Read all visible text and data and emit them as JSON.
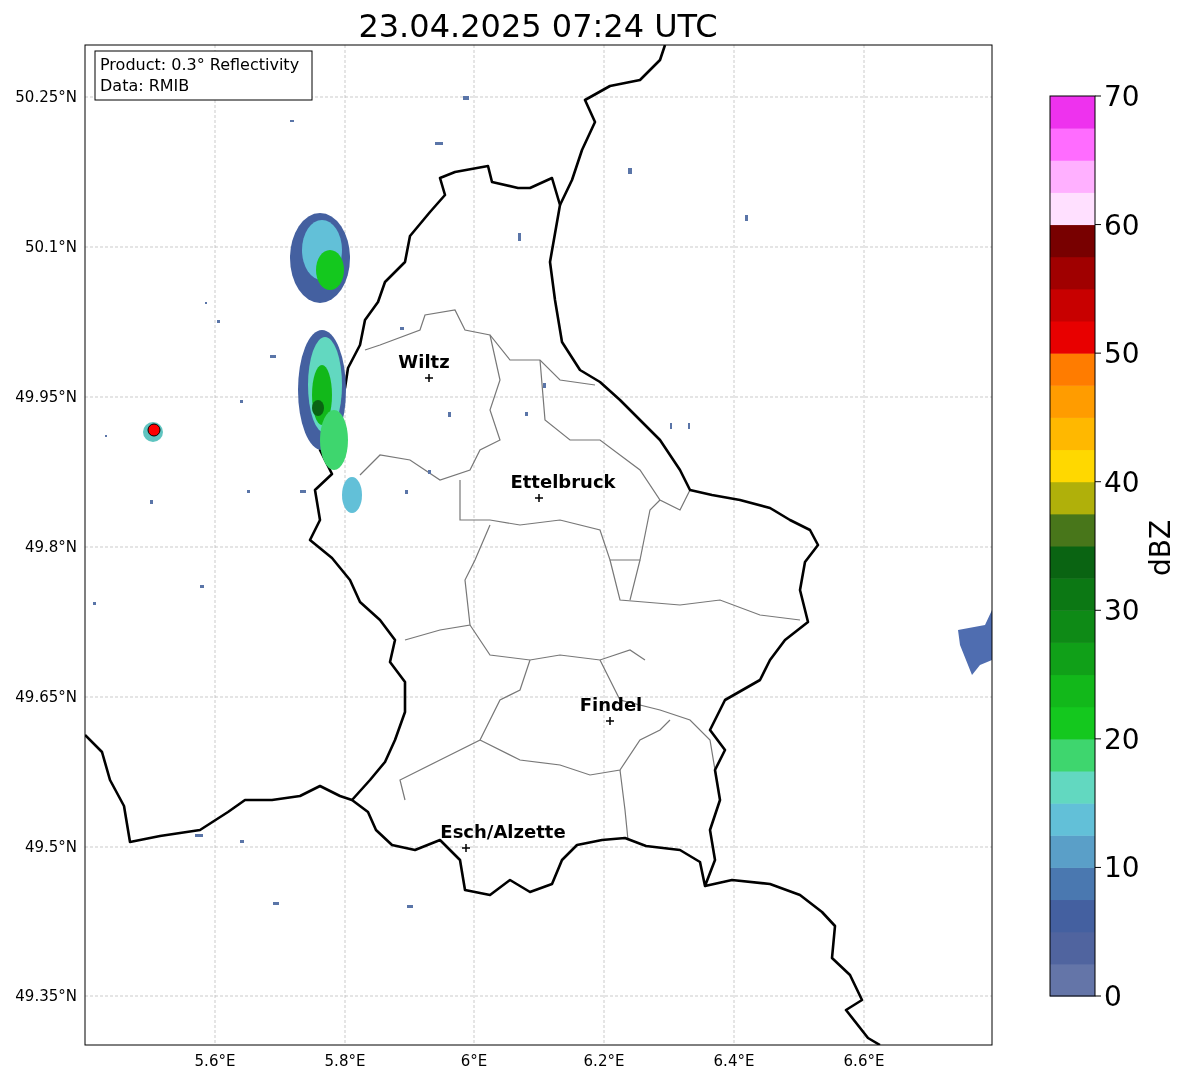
{
  "title": "23.04.2025 07:24 UTC",
  "info_box": [
    "Product: 0.3° Reflectivity",
    "Data: RMIB"
  ],
  "map": {
    "lat_labels": [
      "50.25°N",
      "50.1°N",
      "49.95°N",
      "49.8°N",
      "49.65°N",
      "49.5°N",
      "49.35°N"
    ],
    "lon_labels": [
      "5.6°E",
      "5.8°E",
      "6°E",
      "6.2°E",
      "6.4°E",
      "6.6°E"
    ],
    "cities": [
      {
        "name": "Wiltz"
      },
      {
        "name": "Ettelbruck"
      },
      {
        "name": "Findel"
      },
      {
        "name": "Esch/Alzette"
      }
    ]
  },
  "colorbar": {
    "label": "dBZ",
    "tick_labels": [
      "70",
      "60",
      "50",
      "40",
      "30",
      "20",
      "10",
      "0"
    ],
    "segments": [
      {
        "color": "#6475a8"
      },
      {
        "color": "#50649f"
      },
      {
        "color": "#4460a0"
      },
      {
        "color": "#4a78b0"
      },
      {
        "color": "#5a9fc8"
      },
      {
        "color": "#62c0d8"
      },
      {
        "color": "#62d8c0"
      },
      {
        "color": "#3ed66e"
      },
      {
        "color": "#14c81e"
      },
      {
        "color": "#12b81a"
      },
      {
        "color": "#10a018"
      },
      {
        "color": "#0e8a16"
      },
      {
        "color": "#0c7814"
      },
      {
        "color": "#0a6412"
      },
      {
        "color": "#48761a"
      },
      {
        "color": "#b0b00a"
      },
      {
        "color": "#ffd800"
      },
      {
        "color": "#ffb800"
      },
      {
        "color": "#ff9c00"
      },
      {
        "color": "#ff7c00"
      },
      {
        "color": "#e80000"
      },
      {
        "color": "#c80000"
      },
      {
        "color": "#a00000"
      },
      {
        "color": "#780000"
      },
      {
        "color": "#ffe0ff"
      },
      {
        "color": "#ffb0ff"
      },
      {
        "color": "#ff6cff"
      },
      {
        "color": "#ee32ee"
      }
    ]
  }
}
